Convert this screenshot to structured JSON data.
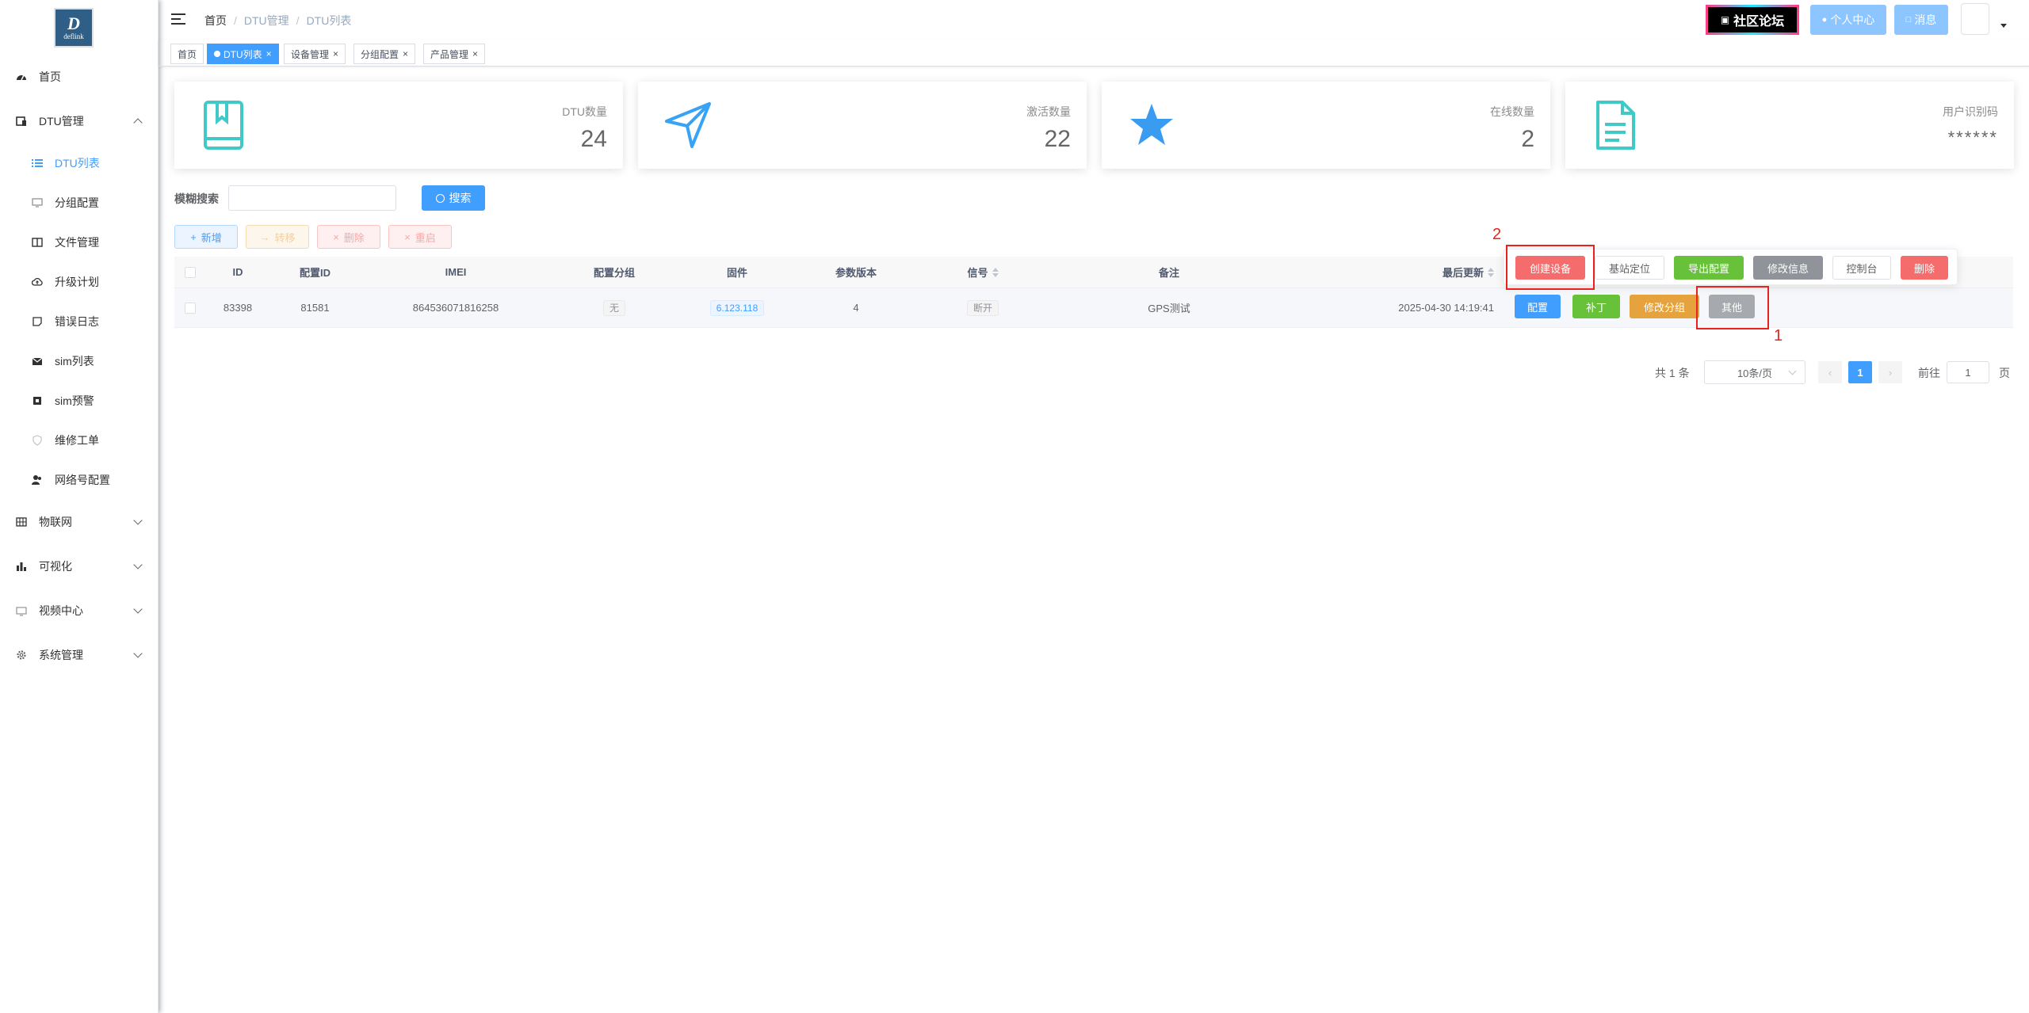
{
  "logo": {
    "letter": "D",
    "text": "deflink"
  },
  "sidebar": {
    "items": [
      {
        "label": "首页",
        "icon": "dashboard-icon"
      },
      {
        "label": "DTU管理",
        "icon": "device-icon"
      },
      {
        "label": "DTU列表",
        "icon": "list-icon"
      },
      {
        "label": "分组配置",
        "icon": "monitor-icon"
      },
      {
        "label": "文件管理",
        "icon": "book-icon"
      },
      {
        "label": "升级计划",
        "icon": "cloud-upload-icon"
      },
      {
        "label": "错误日志",
        "icon": "log-icon"
      },
      {
        "label": "sim列表",
        "icon": "mail-icon"
      },
      {
        "label": "sim预警",
        "icon": "chip-icon"
      },
      {
        "label": "维修工单",
        "icon": "shield-icon"
      },
      {
        "label": "网络号配置",
        "icon": "peoples-icon"
      },
      {
        "label": "物联网",
        "icon": "grid-icon"
      },
      {
        "label": "可视化",
        "icon": "chart-icon"
      },
      {
        "label": "视频中心",
        "icon": "video-icon"
      },
      {
        "label": "系统管理",
        "icon": "gear-icon"
      }
    ]
  },
  "header": {
    "breadcrumb": [
      "首页",
      "DTU管理",
      "DTU列表"
    ],
    "forum_label": "社区论坛",
    "profile_label": "个人中心",
    "message_label": "消息"
  },
  "tags": [
    "首页",
    "DTU列表",
    "设备管理",
    "分组配置",
    "产品管理"
  ],
  "stats": [
    {
      "label": "DTU数量",
      "value": "24",
      "icon": "book-icon",
      "color": "#40c9c6"
    },
    {
      "label": "激活数量",
      "value": "22",
      "icon": "send-icon",
      "color": "#36a3f7"
    },
    {
      "label": "在线数量",
      "value": "2",
      "icon": "star-icon",
      "color": "#3a9cf0"
    },
    {
      "label": "用户识别码",
      "value": "******",
      "icon": "document-icon",
      "color": "#40c9c6"
    }
  ],
  "search": {
    "label": "模糊搜索",
    "placeholder": "",
    "button": "搜索"
  },
  "toolbar": {
    "add": "新增",
    "move": "转移",
    "delete": "删除",
    "restart": "重启"
  },
  "table": {
    "headers": [
      "ID",
      "配置ID",
      "IMEI",
      "配置分组",
      "固件",
      "参数版本",
      "信号",
      "备注",
      "最后更新"
    ],
    "row": {
      "id": "83398",
      "config_id": "81581",
      "imei": "864536071816258",
      "group": "无",
      "firmware": "6.123.118",
      "param_version": "4",
      "signal": "断开",
      "remark": "GPS测试",
      "updated": "2025-04-30 14:19:41"
    },
    "row_actions": [
      "配置",
      "补丁",
      "修改分组",
      "其他"
    ]
  },
  "popover": {
    "actions": [
      "创建设备",
      "基站定位",
      "导出配置",
      "修改信息",
      "控制台",
      "删除"
    ]
  },
  "annotations": {
    "one": "1",
    "two": "2"
  },
  "pagination": {
    "total": "共 1 条",
    "page_size": "10条/页",
    "current": "1",
    "goto": "前往",
    "goto_value": "1",
    "page_unit": "页",
    "prev": "‹",
    "next": "›"
  },
  "colors": {
    "primary": "#409eff",
    "success": "#67c23a",
    "warning": "#e6a23c",
    "danger": "#f56c6c",
    "info": "#909399",
    "annotation": "#e8221c"
  }
}
